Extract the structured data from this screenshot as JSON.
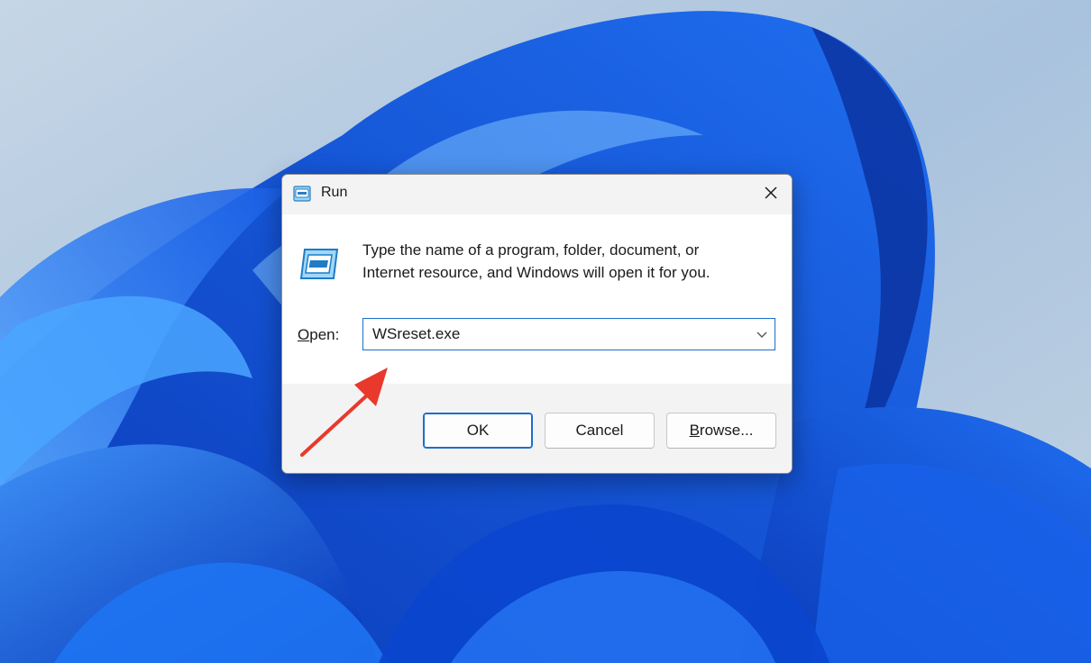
{
  "dialog": {
    "title": "Run",
    "icon": "run-app-icon",
    "close_icon": "close-icon",
    "description_line1": "Type the name of a program, folder, document, or",
    "description_line2": "Internet resource, and Windows will open it for you.",
    "open_label_accel": "O",
    "open_label_rest": "pen:",
    "open_value": "WSreset.exe",
    "dropdown_icon": "chevron-down-icon"
  },
  "buttons": {
    "ok_label": "OK",
    "cancel_label": "Cancel",
    "browse_label_accel": "B",
    "browse_label_rest": "rowse..."
  },
  "colors": {
    "accent": "#1c6fc9",
    "annotation_arrow": "#e8392c",
    "wallpaper_blue": "#0a5be0"
  }
}
